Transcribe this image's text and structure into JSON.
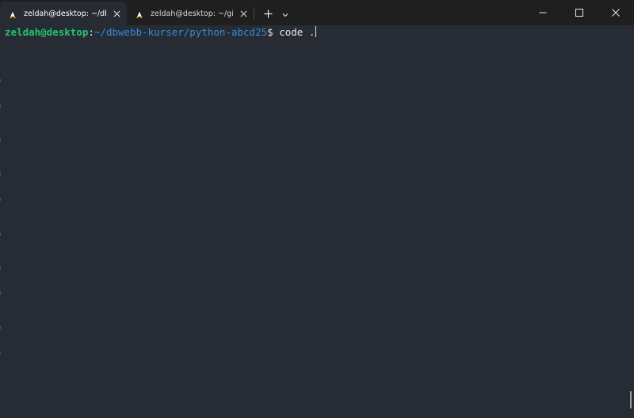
{
  "tabs": [
    {
      "title": "zeldah@desktop: ~/dbwebb-k",
      "icon": "linux-penguin-icon",
      "active": true
    },
    {
      "title": "zeldah@desktop: ~/git/dbwebb",
      "icon": "linux-penguin-icon",
      "active": false
    }
  ],
  "toolbar": {
    "new_tab_icon": "plus-icon",
    "dropdown_icon": "chevron-down-icon"
  },
  "window_controls": {
    "minimize_icon": "minimize-icon",
    "maximize_icon": "maximize-icon",
    "close_icon": "close-icon"
  },
  "terminal": {
    "user_host": "zeldah@desktop",
    "separator": ":",
    "path": "~/dbwebb-kurser/python-abcd25",
    "prompt_symbol": "$",
    "command": " code ."
  },
  "colors": {
    "background": "#272b33",
    "titlebar": "#1f1f1f",
    "user_host": "#23c470",
    "path": "#3a8bd6",
    "text": "#e6e6e6"
  }
}
